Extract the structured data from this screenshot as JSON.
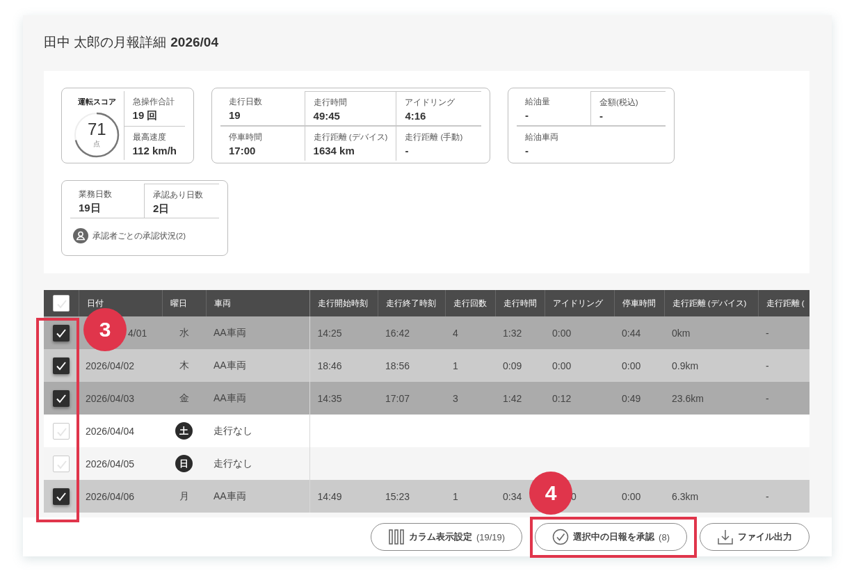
{
  "title": {
    "name": "田中 太郎の月報詳細",
    "period": "2026/04"
  },
  "summary": [
    {
      "kind": "score",
      "score": {
        "label": "運転スコア",
        "value": "71",
        "unit": "点",
        "level": 0.71
      },
      "stats": [
        {
          "label": "急操作合計",
          "value": "19 回"
        },
        {
          "label": "最高速度",
          "value": "112 km/h"
        }
      ]
    },
    {
      "kind": "grid3",
      "stats": [
        {
          "label": "走行日数",
          "value": "19"
        },
        {
          "label": "走行時間",
          "value": "49:45"
        },
        {
          "label": "アイドリング",
          "value": "4:16"
        },
        {
          "label": "停車時間",
          "value": "17:00"
        },
        {
          "label": "走行距離 (デバイス)",
          "value": "1634 km"
        },
        {
          "label": "走行距離 (手動)",
          "value": "-"
        }
      ]
    },
    {
      "kind": "grid2",
      "stats": [
        {
          "label": "給油量",
          "value": "-"
        },
        {
          "label": "金額(税込)",
          "value": "-"
        },
        {
          "label": "給油車両",
          "value": "-"
        }
      ]
    },
    {
      "kind": "approval",
      "stats": [
        {
          "label": "業務日数",
          "value": "19日"
        },
        {
          "label": "承認あり日数",
          "value": "2日"
        }
      ],
      "link": "承認者ごとの承認状況(2)"
    }
  ],
  "table": {
    "select_all": {
      "checked": false
    },
    "columns": [
      "日付",
      "曜日",
      "車両",
      "走行開始時刻",
      "走行終了時刻",
      "走行回数",
      "走行時間",
      "アイドリング",
      "停車時間",
      "走行距離 (デバイス)",
      "走行距離 ("
    ],
    "rows": [
      {
        "checked": true,
        "holiday": false,
        "cells": [
          "4/01",
          "水",
          "AA車両",
          "14:25",
          "16:42",
          "4",
          "1:32",
          "0:00",
          "0:44",
          "0km",
          "-"
        ]
      },
      {
        "checked": true,
        "holiday": false,
        "cells": [
          "2026/04/02",
          "木",
          "AA車両",
          "18:46",
          "18:56",
          "1",
          "0:09",
          "0:00",
          "0:00",
          "0.9km",
          "-"
        ]
      },
      {
        "checked": true,
        "holiday": false,
        "cells": [
          "2026/04/03",
          "金",
          "AA車両",
          "14:35",
          "17:07",
          "3",
          "1:42",
          "0:12",
          "0:49",
          "23.6km",
          "-"
        ]
      },
      {
        "checked": false,
        "holiday": true,
        "cells": [
          "2026/04/04",
          "土",
          "走行なし"
        ]
      },
      {
        "checked": false,
        "holiday": true,
        "cells": [
          "2026/04/05",
          "日",
          "走行なし"
        ]
      },
      {
        "checked": true,
        "holiday": false,
        "cells": [
          "2026/04/06",
          "月",
          "AA車両",
          "14:49",
          "15:23",
          "1",
          "0:34",
          "0",
          "0:00",
          "6.3km",
          "-"
        ]
      }
    ]
  },
  "actions": [
    {
      "kind": "columns",
      "label": "カラム表示設定",
      "count": "(19/19)"
    },
    {
      "kind": "approve",
      "label": "選択中の日報を承認",
      "count": "(8)"
    },
    {
      "kind": "export",
      "label": "ファイル出力"
    }
  ],
  "annotations": [
    {
      "label": "3"
    },
    {
      "label": "4"
    }
  ]
}
